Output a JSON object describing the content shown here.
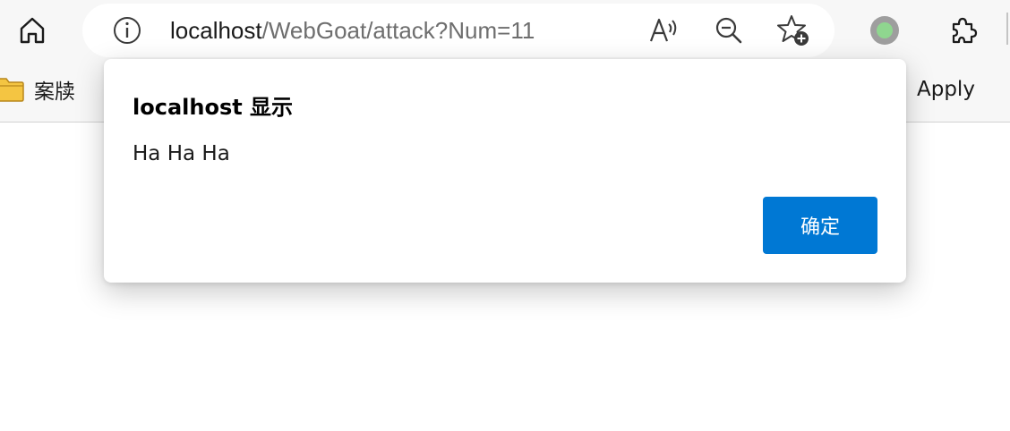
{
  "toolbar": {
    "url_host": "localhost",
    "url_path": "/WebGoat/attack?Num=11",
    "icons": {
      "home": "home-icon",
      "info": "info-icon",
      "read_aloud": "read-aloud-icon",
      "zoom_out": "zoom-out-icon",
      "add_favorite": "add-favorite-icon",
      "profile": "profile-icon",
      "extensions": "extensions-icon"
    }
  },
  "bookmarks": {
    "items": [
      {
        "label": "案牍",
        "icon": "folder-icon"
      },
      {
        "label": "Apply"
      }
    ]
  },
  "dialog": {
    "title": "localhost 显示",
    "message": "Ha Ha Ha",
    "ok_label": "确定"
  },
  "colors": {
    "accent": "#0078d4",
    "toolbar_bg": "#f7f7f7",
    "profile_dot": "#8fd68f",
    "folder": "#f4c542"
  }
}
